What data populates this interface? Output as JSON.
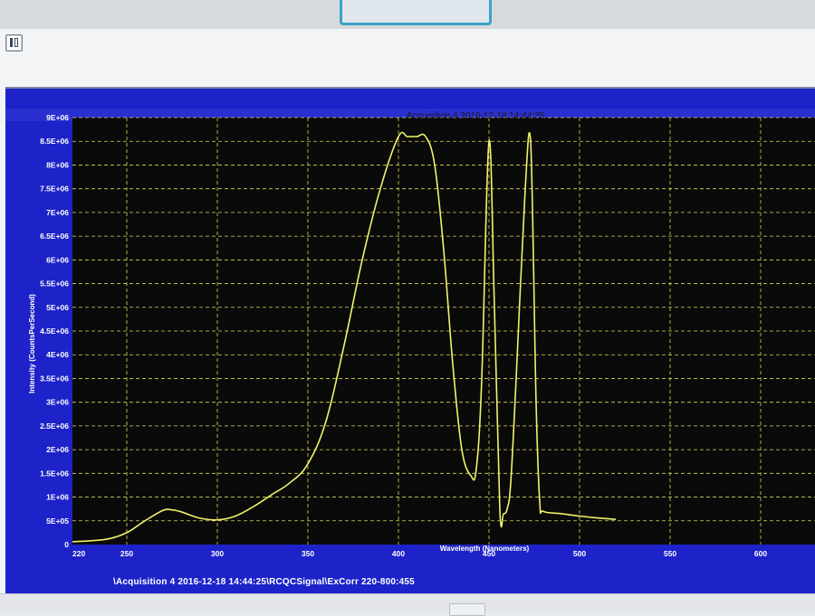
{
  "window": {
    "footer_path": "\\Acquisition 4 2016-12-18 14:44:25\\RCQCSignal\\ExCorr 220-800:455"
  },
  "colors": {
    "plot_background": "#0a0a0a",
    "frame_background": "#1d23c8",
    "grid": "#d9d75a",
    "series": "#f2f26a",
    "axis_text": "#ffffff"
  },
  "chart_data": {
    "type": "line",
    "title": "Acquisition 4 2016-12-18 14:44:25",
    "xlabel": "Wavelength (Nanometers)",
    "ylabel": "Intensity (CountsPerSecond)",
    "xlim": [
      220,
      630
    ],
    "ylim": [
      0,
      9000000
    ],
    "grid": true,
    "x_ticks": [
      "220",
      "250",
      "300",
      "350",
      "400",
      "450",
      "500",
      "550",
      "600"
    ],
    "x_tick_values": [
      220,
      250,
      300,
      350,
      400,
      450,
      500,
      550,
      600
    ],
    "y_ticks": [
      "0",
      "5E+05",
      "1E+06",
      "1.5E+06",
      "2E+06",
      "2.5E+06",
      "3E+06",
      "3.5E+06",
      "4E+06",
      "4.5E+06",
      "5E+06",
      "5.5E+06",
      "6E+06",
      "6.5E+06",
      "7E+06",
      "7.5E+06",
      "8E+06",
      "8.5E+06",
      "9E+06"
    ],
    "y_tick_values": [
      0,
      500000,
      1000000,
      1500000,
      2000000,
      2500000,
      3000000,
      3500000,
      4000000,
      4500000,
      5000000,
      5500000,
      6000000,
      6500000,
      7000000,
      7500000,
      8000000,
      8500000,
      9000000
    ],
    "series": [
      {
        "x": [
          220,
          230,
          240,
          250,
          260,
          270,
          275,
          280,
          290,
          300,
          310,
          320,
          330,
          340,
          350,
          360,
          370,
          380,
          390,
          400,
          405,
          410,
          415,
          420,
          425,
          430,
          435,
          440,
          443,
          446,
          450,
          453,
          456,
          458,
          460,
          462,
          465,
          470,
          473,
          476,
          478,
          480,
          490,
          500,
          510,
          520
        ],
        "y": [
          60000,
          80000,
          120000,
          250000,
          500000,
          720000,
          730000,
          690000,
          560000,
          520000,
          600000,
          800000,
          1050000,
          1300000,
          1700000,
          2600000,
          4200000,
          6000000,
          7500000,
          8600000,
          8600000,
          8600000,
          8600000,
          8000000,
          6200000,
          3800000,
          2000000,
          1450000,
          1600000,
          3500000,
          8500000,
          5000000,
          700000,
          650000,
          750000,
          1300000,
          3500000,
          7500000,
          8500000,
          3000000,
          900000,
          700000,
          650000,
          600000,
          560000,
          530000
        ]
      }
    ]
  }
}
